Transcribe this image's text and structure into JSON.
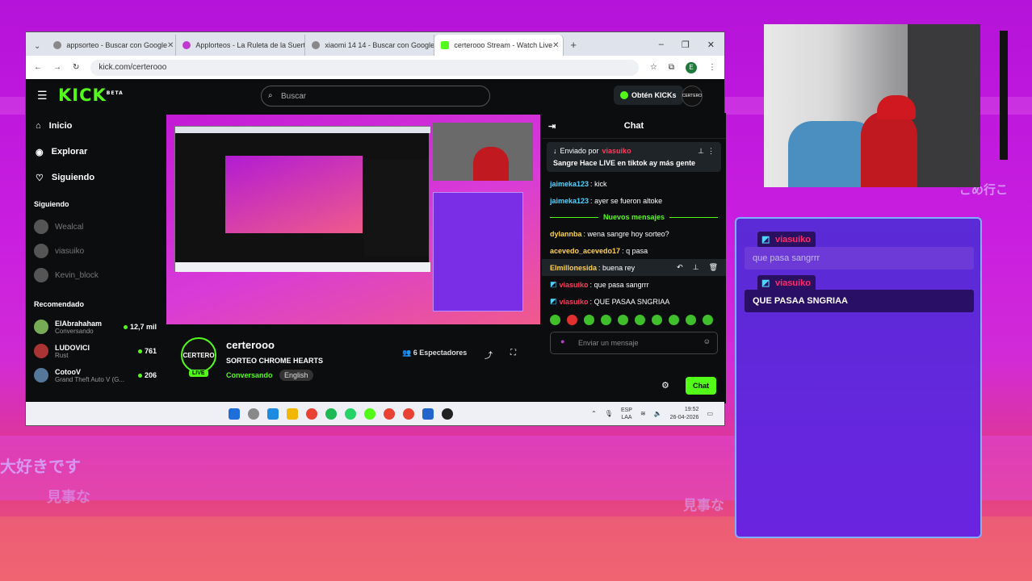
{
  "browser": {
    "tabs": [
      {
        "label": "appsorteo - Buscar con Google"
      },
      {
        "label": "Applorteos - La Ruleta de la Suerte"
      },
      {
        "label": "xiaomi 14 14 - Buscar con Google"
      },
      {
        "label": "certerooo Stream - Watch Live"
      }
    ],
    "url": "kick.com/certerooo",
    "profile_initial": "E"
  },
  "kick": {
    "logo": "KICK",
    "logo_beta": "BETA",
    "search_placeholder": "Buscar",
    "kicks_button": "Obtén KICKs",
    "user_avatar_text": "CERTERO"
  },
  "sidebar": {
    "nav": [
      {
        "label": "Inicio",
        "icon": "home-icon"
      },
      {
        "label": "Explorar",
        "icon": "compass-icon"
      },
      {
        "label": "Siguiendo",
        "icon": "heart-icon"
      }
    ],
    "following_header": "Siguiendo",
    "following": [
      {
        "name": "Wealcal"
      },
      {
        "name": "viasuiko"
      },
      {
        "name": "Kevin_block"
      }
    ],
    "recommended_header": "Recomendado",
    "recommended": [
      {
        "name": "ElAbrahaham",
        "category": "Conversando",
        "viewers": "12,7 mil"
      },
      {
        "name": "LUDOVICI",
        "category": "Rust",
        "viewers": "761"
      },
      {
        "name": "CotooV",
        "category": "Grand Theft Auto V (G...",
        "viewers": "206"
      }
    ]
  },
  "channel": {
    "logo_text": "CERTERO",
    "live_badge": "LIVE",
    "name": "certerooo",
    "title": "SORTEO CHROME HEARTS",
    "category": "Conversando",
    "language": "English",
    "viewers": "6 Espectadores"
  },
  "chat": {
    "header": "Chat",
    "pinned": {
      "by_label": "Enviado por",
      "by_user": "viasuiko",
      "text": "Sangre Hace LIVE en tiktok ay más gente"
    },
    "messages_before": [
      {
        "user": "jaimeka123",
        "text": "kick",
        "color": "#4fd3ff"
      },
      {
        "user": "jaimeka123",
        "text": "ayer se fueron altoke",
        "color": "#4fd3ff"
      }
    ],
    "new_messages_label": "Nuevos mensajes",
    "messages_after": [
      {
        "user": "dylannba",
        "text": "wena sangre hoy sorteo?",
        "color": "#ffd24d"
      },
      {
        "user": "acevedo_acevedo17",
        "text": "q pasa",
        "color": "#ffd24d"
      },
      {
        "user": "Elmillonesida",
        "text": "buena rey",
        "color": "#ffd24d"
      },
      {
        "user": "viasuiko",
        "text": "que pasa sangrrr",
        "color": "#ff3b5c"
      },
      {
        "user": "viasuiko",
        "text": "QUE PASAA SNGRIAA",
        "color": "#ff3b5c"
      }
    ],
    "input_placeholder": "Enviar un mensaje",
    "send_button": "Chat"
  },
  "taskbar": {
    "lang_top": "ESP",
    "lang_bottom": "LAA",
    "time": "19:52",
    "date": "26-04-2026"
  },
  "overlay_chat": {
    "messages": [
      {
        "user": "viasuiko",
        "text": "que pasa sangrrr"
      },
      {
        "user": "viasuiko",
        "text": "QUE PASAA SNGRIAA"
      }
    ]
  },
  "background_text": {
    "jp1": "大好きです",
    "jp2": "見事な",
    "jp3": "見事な",
    "jp4": "ごめ行こ",
    "jp5": "大好きです",
    "jp6": "見事な"
  }
}
